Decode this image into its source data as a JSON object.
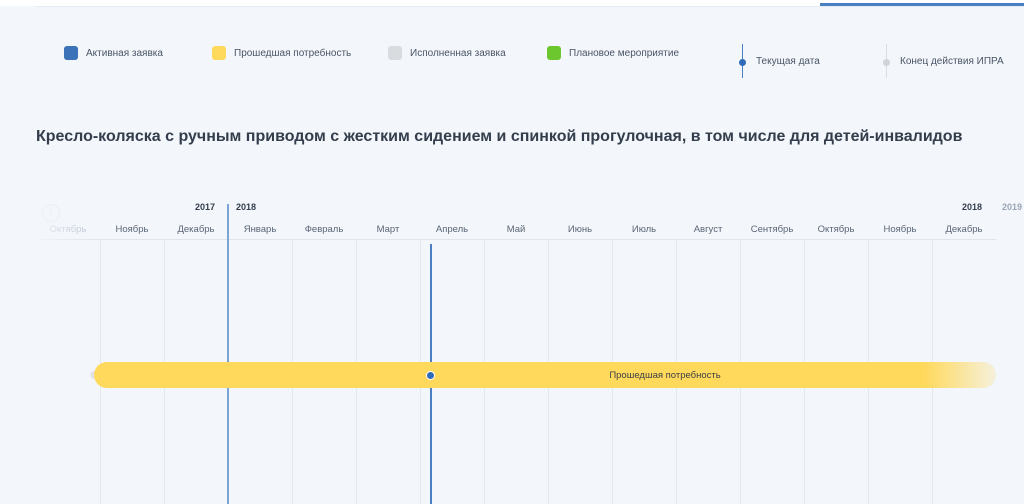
{
  "legend": [
    {
      "label": "Активная заявка",
      "color": "#3b72b8",
      "kind": "swatch"
    },
    {
      "label": "Прошедшая потребность",
      "color": "#ffd95c",
      "kind": "swatch"
    },
    {
      "label": "Исполненная заявка",
      "color": "#d9dcdf",
      "kind": "swatch"
    },
    {
      "label": "Плановое мероприятие",
      "color": "#6cc72f",
      "kind": "swatch"
    },
    {
      "label": "Текущая дата",
      "kind": "line"
    },
    {
      "label": "Конец действия ИПРА",
      "kind": "line-gray"
    }
  ],
  "title": "Кресло-коляска с ручным приводом с жестким сидением и спинкой прогулочная, в том числе для детей-инвалидов",
  "timeline": {
    "years": [
      "2017",
      "2018",
      "2018",
      "2019"
    ],
    "months": [
      "Октябрь",
      "Ноябрь",
      "Декабрь",
      "Январь",
      "Февраль",
      "Март",
      "Апрель",
      "Май",
      "Июнь",
      "Июль",
      "Август",
      "Сентябрь",
      "Октябрь",
      "Ноябрь",
      "Декабрь"
    ],
    "bar_label": "Прошедшая потребность",
    "bar_color": "#ffd95c",
    "info_icon": "i"
  }
}
